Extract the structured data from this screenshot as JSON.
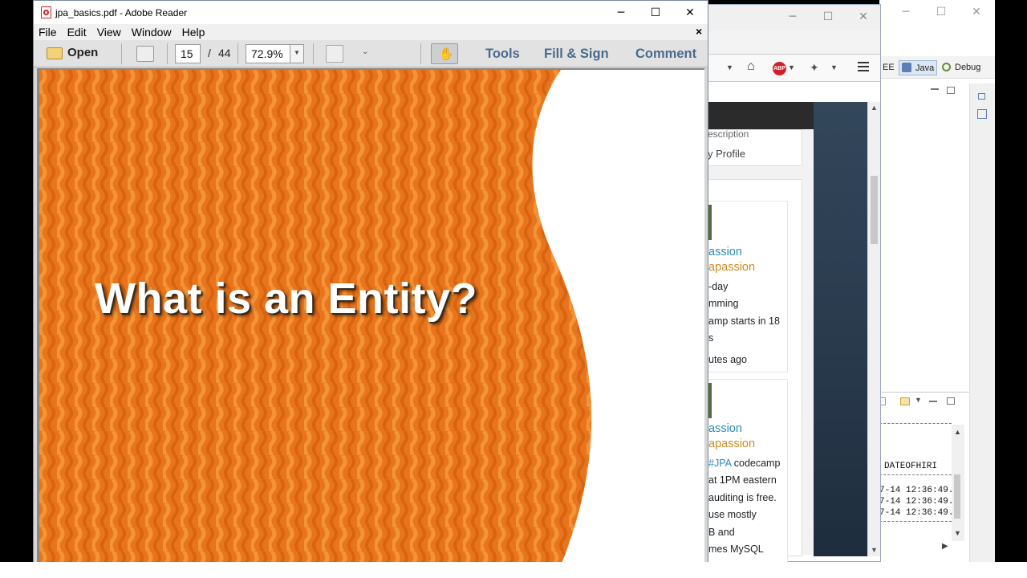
{
  "reader": {
    "window_title": "jpa_basics.pdf - Adobe Reader",
    "menu": [
      "File",
      "Edit",
      "View",
      "Window",
      "Help"
    ],
    "menu_close": "×",
    "toolbar": {
      "open_label": "Open",
      "page_current": "15",
      "page_separator": "/",
      "page_total": "44",
      "zoom": "72.9%",
      "tools_label": "Tools",
      "fill_sign_label": "Fill & Sign",
      "comment_label": "Comment"
    },
    "slide": {
      "title": "What is an Entity?",
      "bg_color": "#e8741e",
      "stripe_color": "#f08a2a"
    },
    "caption_buttons": [
      "─",
      "☐",
      "✕"
    ]
  },
  "firefox": {
    "caption_buttons": [
      "─",
      "☐",
      "✕"
    ],
    "sidebar_partial_1": "escription",
    "sidebar_partial_2": "y Profile",
    "tweets": [
      {
        "name": "assion",
        "handle": "apassion",
        "lines": [
          "-day",
          "mming",
          "amp starts in 18",
          "s"
        ],
        "time": "utes ago"
      },
      {
        "name": "assion",
        "handle": "apassion",
        "lines_prefix": "#JPA",
        "lines_first_rest": " codecamp",
        "lines": [
          "at 1PM eastern",
          "auditing is free.",
          " use mostly",
          "B and",
          "mes MySQL"
        ]
      }
    ]
  },
  "eclipse": {
    "caption_buttons": [
      "─",
      "☐",
      "✕"
    ],
    "perspectives": {
      "ee": "EE",
      "java": "Java",
      "debug": "Debug"
    },
    "column_header": "DATEOFHIRI",
    "rows": [
      "7-14 12:36:49.",
      "7-14 12:36:49.",
      "7-14 12:36:49."
    ],
    "colors": {
      "accent": "#e8741e",
      "firefox_blue": "#2a8ab8",
      "firefox_handle": "#d08a20"
    }
  }
}
